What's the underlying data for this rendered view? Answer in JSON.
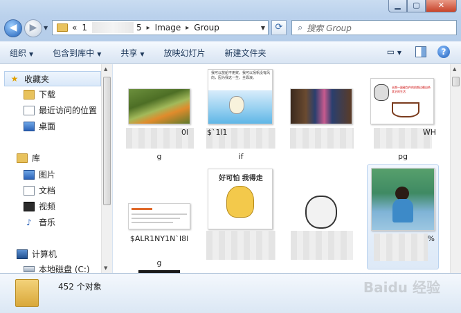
{
  "window": {
    "minimize_glyph": "▁",
    "maximize_glyph": "▢",
    "close_glyph": "✕"
  },
  "nav": {
    "back_glyph": "◀",
    "forward_glyph": "▶",
    "history_glyph": "▼",
    "refresh_glyph": "⟳"
  },
  "address": {
    "prefix": "«",
    "crumbs": [
      "1",
      "5",
      "Image",
      "Group"
    ],
    "separator": "▸"
  },
  "search": {
    "placeholder": "搜索 Group",
    "icon": "search-icon"
  },
  "commandbar": {
    "organize": "组织",
    "include_in_library": "包含到库中",
    "share": "共享",
    "slideshow": "放映幻灯片",
    "new_folder": "新建文件夹"
  },
  "navpane": {
    "favorites": "收藏夹",
    "downloads": "下载",
    "recent": "最近访问的位置",
    "desktop": "桌面",
    "libraries": "库",
    "pictures": "图片",
    "documents": "文档",
    "videos": "视频",
    "music": "音乐",
    "computer": "计算机",
    "local_disk": "本地磁盘 (C:)"
  },
  "files": [
    {
      "line1": "0l",
      "line2": "g"
    },
    {
      "line1": "$`1l1",
      "line2": "if"
    },
    {
      "line1": "",
      "line2": ""
    },
    {
      "line1": "WH",
      "line2": "pg"
    },
    {
      "line1": "$ALR1NY1N`I8l",
      "line2": "g"
    },
    {
      "line1": "",
      "line2": ""
    },
    {
      "line1": "",
      "line2": ""
    },
    {
      "line1": "%",
      "line2": ""
    }
  ],
  "thumbs": {
    "t2_text": "我可以放船不用桨，我可以扬帆没有风向，因为我这一生，全靠浪。",
    "t4_text": "长期一副破包件的前期过剩自杀其它的生活",
    "t6_text": "好可怕 我得走"
  },
  "status": {
    "count": "452 个对象"
  },
  "watermark": "Baidu 经验",
  "colors": {
    "accent": "#1f5fb8",
    "command_text": "#1e395b",
    "selection": "#d9e8f9"
  }
}
